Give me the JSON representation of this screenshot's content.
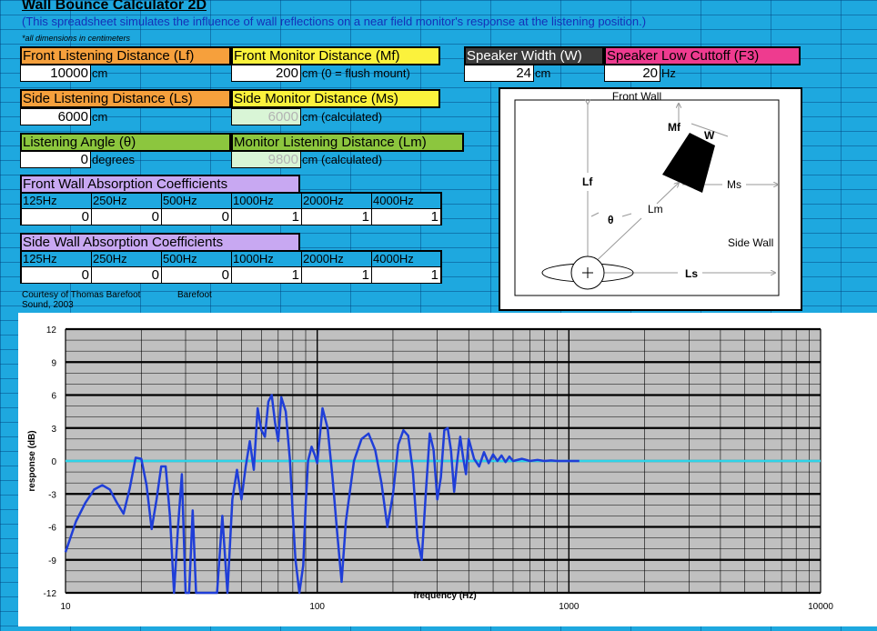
{
  "header": {
    "title": "Wall Bounce Calculator 2D",
    "subtitle": "(This spreadsheet simulates the influence of wall reflections on a near field monitor's response at the listening position.)",
    "note": "*all dimensions in centimeters"
  },
  "fields": {
    "front_listening": {
      "label": "Front Listening Distance (Lf)",
      "value": "10000",
      "unit": "cm"
    },
    "front_monitor": {
      "label": "Front Monitor Distance (Mf)",
      "value": "200",
      "unit": "cm  (0 = flush mount)"
    },
    "speaker_width": {
      "label": "Speaker Width (W)",
      "value": "24",
      "unit": "cm"
    },
    "speaker_cutoff": {
      "label": "Speaker Low Cuttoff (F3)",
      "value": "20",
      "unit": "Hz"
    },
    "side_listening": {
      "label": "Side Listening Distance (Ls)",
      "value": "6000",
      "unit": "cm"
    },
    "side_monitor": {
      "label": "Side Monitor Distance (Ms)",
      "value": "6000",
      "unit": "cm  (calculated)"
    },
    "listening_angle": {
      "label": "Listening Angle (θ)",
      "value": "0",
      "unit": "degrees"
    },
    "monitor_listening": {
      "label": "Monitor Listening Distance (Lm)",
      "value": "9800",
      "unit": "cm  (calculated)"
    }
  },
  "front_wall_absorption": {
    "label": "Front Wall Absorption Coefficients",
    "bands": [
      "125Hz",
      "250Hz",
      "500Hz",
      "1000Hz",
      "2000Hz",
      "4000Hz"
    ],
    "values": [
      "0",
      "0",
      "0",
      "1",
      "1",
      "1"
    ]
  },
  "side_wall_absorption": {
    "label": "Side Wall Absorption Coefficients",
    "bands": [
      "125Hz",
      "250Hz",
      "500Hz",
      "1000Hz",
      "2000Hz",
      "4000Hz"
    ],
    "values": [
      "0",
      "0",
      "0",
      "1",
      "1",
      "1"
    ]
  },
  "credit": {
    "line1": "Courtesy of Thomas Barefoot",
    "line2": "Barefoot",
    "line3": "Sound, 2003"
  },
  "diagram": {
    "front_wall": "Front Wall",
    "side_wall": "Side Wall",
    "lf": "Lf",
    "mf": "Mf",
    "w": "W",
    "ms": "Ms",
    "lm": "Lm",
    "theta": "θ",
    "ls": "Ls"
  },
  "chart_data": {
    "type": "line",
    "xlabel": "frequency (Hz)",
    "ylabel": "response (dB)",
    "xscale": "log",
    "xlim": [
      10,
      10000
    ],
    "ylim": [
      -12,
      12
    ],
    "xticks": [
      "10",
      "100",
      "1000",
      "10000"
    ],
    "yticks": [
      "12",
      "9",
      "6",
      "3",
      "0",
      "-3",
      "-6",
      "-9",
      "-12"
    ],
    "grid": true,
    "zero_line_color": "#2ed3e8",
    "series_color": "#1f3ed8",
    "x": [
      10,
      11,
      12,
      13,
      14,
      15,
      16,
      17,
      18,
      19,
      20,
      21,
      22,
      23,
      24,
      25,
      26,
      27,
      28,
      29,
      30,
      31,
      32,
      33,
      34,
      35,
      36,
      38,
      40,
      42,
      44,
      46,
      48,
      50,
      52,
      54,
      56,
      58,
      60,
      62,
      64,
      66,
      68,
      70,
      72,
      75,
      78,
      80,
      82,
      85,
      88,
      90,
      92,
      95,
      98,
      100,
      105,
      110,
      115,
      120,
      125,
      130,
      140,
      150,
      160,
      170,
      180,
      190,
      200,
      210,
      220,
      230,
      240,
      250,
      260,
      270,
      280,
      290,
      300,
      310,
      320,
      330,
      340,
      350,
      360,
      370,
      380,
      390,
      400,
      420,
      440,
      460,
      480,
      500,
      520,
      540,
      560,
      580,
      600,
      650,
      700,
      750,
      800,
      850,
      900,
      950,
      1000,
      1050,
      1100
    ],
    "y": [
      -8.3,
      -5.5,
      -3.8,
      -2.6,
      -2.2,
      -2.6,
      -3.8,
      -4.8,
      -2.5,
      0.3,
      0.2,
      -2.2,
      -6.2,
      -3.5,
      -0.5,
      -0.5,
      -5.0,
      -12.0,
      -6.0,
      -1.2,
      -12.0,
      -12.0,
      -4.5,
      -12.0,
      -12.0,
      -12.0,
      -12.0,
      -12.0,
      -12.0,
      -5.0,
      -12.0,
      -3.5,
      -0.8,
      -3.5,
      -0.5,
      1.8,
      -0.8,
      4.8,
      2.8,
      2.2,
      5.4,
      6.0,
      3.5,
      1.8,
      5.8,
      4.5,
      0.0,
      -5.0,
      -9.0,
      -12.0,
      -9.5,
      -4.0,
      0.0,
      1.3,
      0.5,
      -0.2,
      4.8,
      3.0,
      -1.5,
      -6.5,
      -11.0,
      -5.5,
      0.0,
      2.0,
      2.5,
      1.0,
      -2.0,
      -6.0,
      -3.0,
      1.5,
      2.8,
      2.3,
      -1.0,
      -7.0,
      -9.0,
      -3.0,
      2.5,
      1.0,
      -3.5,
      -1.5,
      2.8,
      3.0,
      1.0,
      -2.8,
      0.0,
      2.2,
      0.3,
      -1.2,
      2.0,
      0.2,
      -0.5,
      0.8,
      -0.2,
      0.6,
      0.0,
      0.5,
      -0.1,
      0.4,
      0.0,
      0.2,
      0.0,
      0.1,
      0.0,
      0.05,
      0.0,
      0.0,
      0.0,
      0.0,
      0.0
    ]
  }
}
